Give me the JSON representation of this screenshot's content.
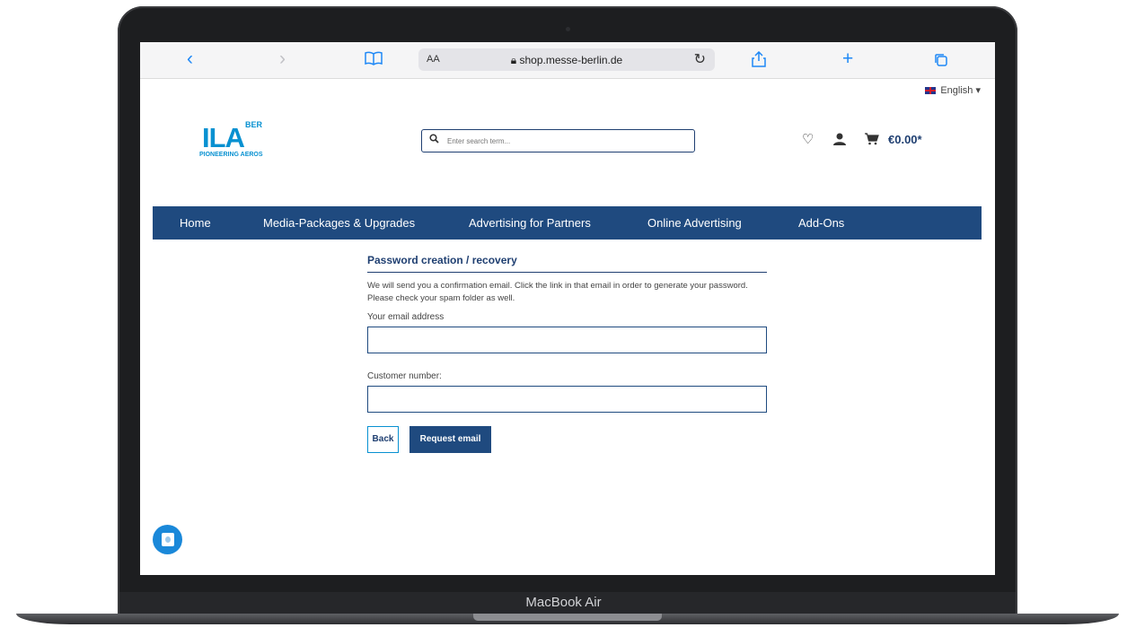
{
  "device": {
    "label": "MacBook Air"
  },
  "browser": {
    "text_size_label": "AA",
    "url": "shop.messe-berlin.de"
  },
  "site": {
    "language": "English",
    "logo": {
      "main": "ILA",
      "superscript": "BER",
      "tagline": "PIONEERING AEROS"
    },
    "search": {
      "placeholder": "Enter search term..."
    },
    "cart": {
      "total": "€0.00*"
    },
    "nav": {
      "items": [
        "Home",
        "Media-Packages & Upgrades",
        "Advertising for Partners",
        "Online Advertising",
        "Add-Ons"
      ]
    }
  },
  "form": {
    "title": "Password creation / recovery",
    "description": "We will send you a confirmation email. Click the link in that email in order to generate your password. Please check your spam folder as well.",
    "email_label": "Your email address",
    "email_value": "",
    "customer_label": "Customer number:",
    "customer_value": "",
    "back_label": "Back",
    "submit_label": "Request email"
  },
  "colors": {
    "brand_blue": "#0891d1",
    "nav_blue": "#1f4a7f",
    "chat_blue": "#1a88d9"
  }
}
